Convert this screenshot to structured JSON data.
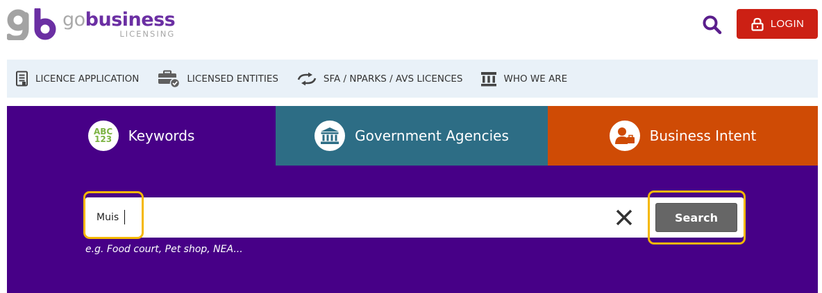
{
  "header": {
    "logo": {
      "mark_icon": "gb-logo-icon",
      "word_prefix": "go",
      "word_main": "business",
      "sub": "LICENSING",
      "colors": {
        "gray": "#a9a9a9",
        "purple": "#6b2fa3"
      }
    },
    "search_icon": "search-icon",
    "login_label": "LOGIN",
    "login_color": "#cc2014"
  },
  "nav": {
    "items": [
      {
        "label": "LICENCE APPLICATION",
        "icon": "document-icon"
      },
      {
        "label": "LICENSED ENTITIES",
        "icon": "briefcase-check-icon"
      },
      {
        "label": "SFA / NPARKS / AVS LICENCES",
        "icon": "exchange-arrows-icon"
      },
      {
        "label": "WHO WE ARE",
        "icon": "government-building-icon"
      }
    ],
    "background": "#e9f1f8"
  },
  "tabs": [
    {
      "label": "Keywords",
      "icon": "abc-123-icon",
      "icon_text_top": "ABC",
      "icon_text_bottom": "123",
      "color": "#470087"
    },
    {
      "label": "Government Agencies",
      "icon": "government-building-icon",
      "color": "#2d6d85"
    },
    {
      "label": "Business Intent",
      "icon": "business-person-icon",
      "color": "#cf4b05"
    }
  ],
  "search": {
    "value": "Muis",
    "hint": "e.g. Food court, Pet shop, NEA...",
    "clear_icon": "close-icon",
    "button_label": "Search"
  },
  "highlight_color": "#f5b800"
}
